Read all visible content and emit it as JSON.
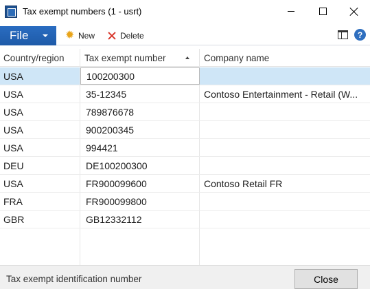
{
  "window": {
    "title": "Tax exempt numbers (1 - usrt)"
  },
  "toolbar": {
    "file_label": "File",
    "new_label": "New",
    "delete_label": "Delete"
  },
  "grid": {
    "columns": [
      "Country/region",
      "Tax exempt number",
      "Company name"
    ],
    "sorted_column": "Tax exempt number",
    "sort_direction": "ascending",
    "rows": [
      {
        "country": "USA",
        "number": "100200300",
        "company": ""
      },
      {
        "country": "USA",
        "number": "35-12345",
        "company": "Contoso Entertainment - Retail (W..."
      },
      {
        "country": "USA",
        "number": "789876678",
        "company": ""
      },
      {
        "country": "USA",
        "number": "900200345",
        "company": ""
      },
      {
        "country": "USA",
        "number": "994421",
        "company": ""
      },
      {
        "country": "DEU",
        "number": "DE100200300",
        "company": ""
      },
      {
        "country": "USA",
        "number": "FR900099600",
        "company": "Contoso Retail FR"
      },
      {
        "country": "FRA",
        "number": "FR900099800",
        "company": ""
      },
      {
        "country": "GBR",
        "number": "GB12332112",
        "company": ""
      }
    ]
  },
  "status": {
    "text": "Tax exempt identification number",
    "close_label": "Close"
  },
  "colors": {
    "file_button": "#1e5aa8",
    "selected_row": "#cfe6f7",
    "delete_icon": "#d8362b",
    "new_icon": "#e9a419",
    "help_icon": "#2f6fbf"
  },
  "icons": {
    "app": "app-icon",
    "new": "new-star-icon",
    "delete": "delete-x-icon",
    "panel": "panel-layout-icon",
    "help": "help-icon"
  }
}
